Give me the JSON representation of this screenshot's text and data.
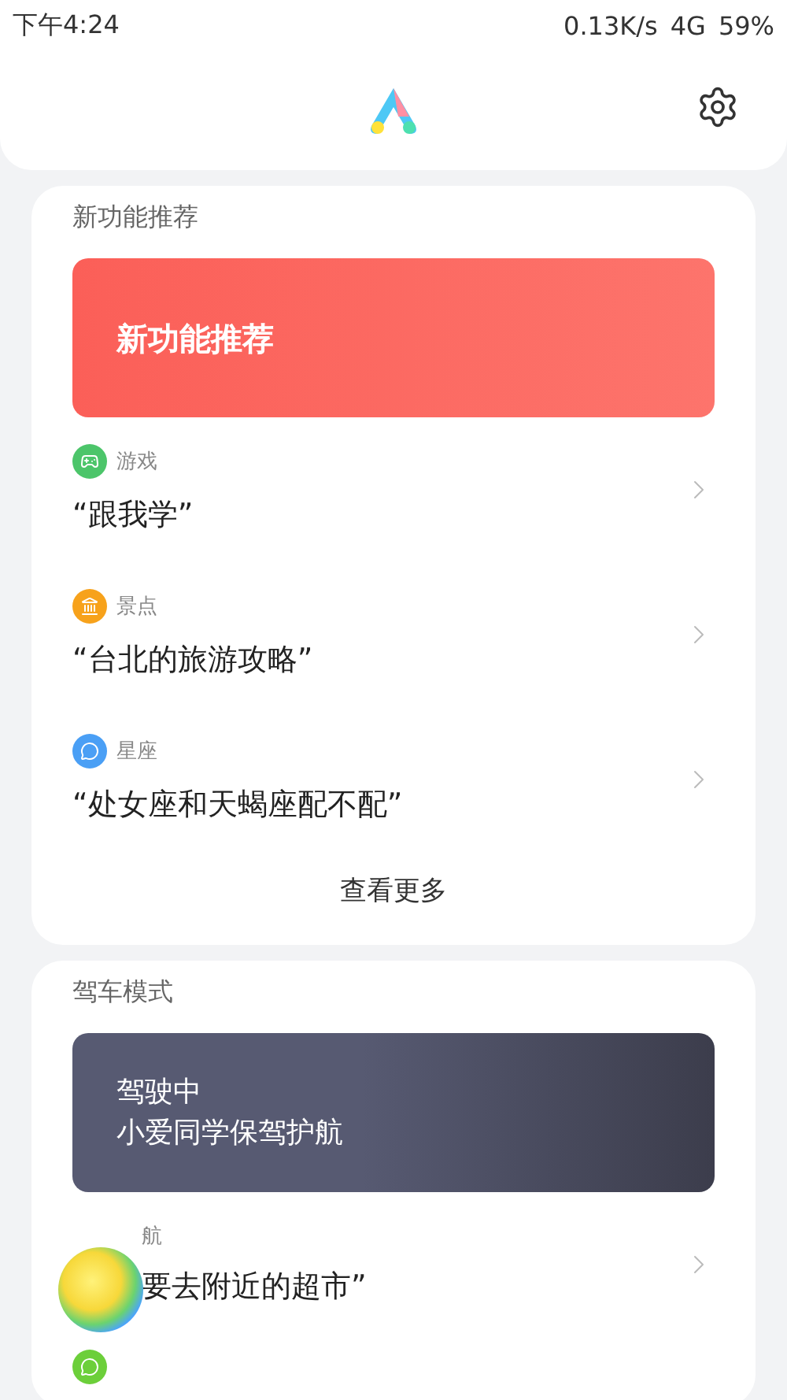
{
  "status_bar": {
    "time": "下午4:24",
    "speed": "0.13K/s",
    "network": "4G",
    "battery": "59%"
  },
  "sections": [
    {
      "title": "新功能推荐",
      "banner": {
        "kind": "new",
        "lines": [
          "新功能推荐"
        ]
      },
      "items": [
        {
          "kind": "suggestion",
          "category": "游戏",
          "color": "#4cc56a",
          "text": "“跟我学”"
        },
        {
          "kind": "suggestion",
          "category": "景点",
          "color": "#f7a21b",
          "text": "“台北的旅游攻略”"
        },
        {
          "kind": "suggestion",
          "category": "星座",
          "color": "#4a9ff5",
          "text": "“处女座和天蝎座配不配”"
        }
      ],
      "more": "查看更多"
    },
    {
      "title": "驾车模式",
      "banner": {
        "kind": "drive",
        "lines": [
          "驾驶中",
          "小爱同学保驾护航"
        ]
      },
      "items": [
        {
          "kind": "covered",
          "category": "航",
          "text": "要去附近的超市”"
        },
        {
          "kind": "partial",
          "color": "#6ccf3a"
        }
      ]
    }
  ]
}
